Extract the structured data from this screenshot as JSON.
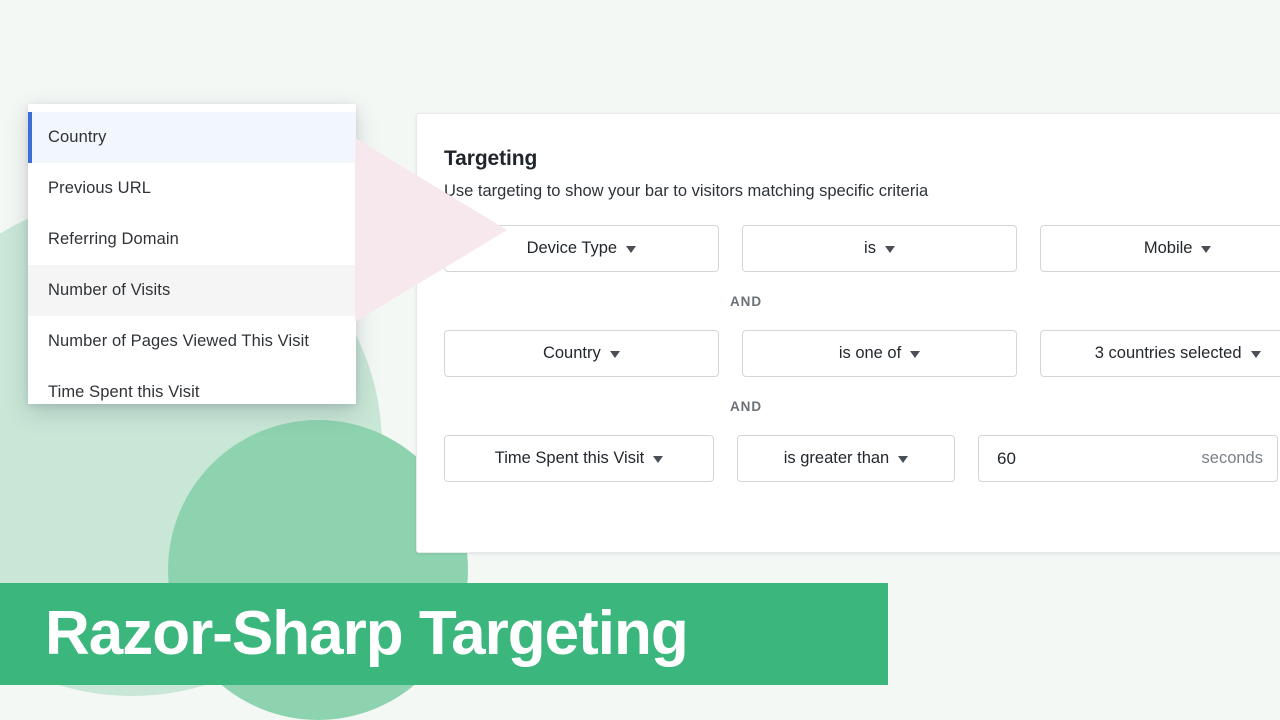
{
  "theme": {
    "page_background": "#f4f8f5",
    "accent_green": "#3bb77e",
    "shape_green_light": "#c9e7d7",
    "shape_green_mid": "#8ed3b0",
    "shape_pink": "#f6e8ec",
    "selected_blue": "#3a6fd8",
    "selected_row_bg": "#f2f6fd",
    "hover_row_bg": "#f5f5f5"
  },
  "dropdown": {
    "items": [
      {
        "label": "Country",
        "state": "selected"
      },
      {
        "label": "Previous URL",
        "state": "normal"
      },
      {
        "label": "Referring Domain",
        "state": "normal"
      },
      {
        "label": "Number of Visits",
        "state": "hovered"
      },
      {
        "label": "Number of Pages Viewed This Visit",
        "state": "normal"
      },
      {
        "label": "Time Spent this Visit",
        "state": "normal"
      }
    ]
  },
  "card": {
    "title": "Targeting",
    "subtitle": "Use targeting to show your bar to visitors matching specific criteria",
    "conjunction": "AND",
    "rules": [
      {
        "field": "Device Type",
        "operator": "is",
        "value": "Mobile"
      },
      {
        "field": "Country",
        "operator": "is one of",
        "value": "3 countries selected"
      },
      {
        "field": "Time Spent this Visit",
        "operator": "is greater than",
        "value": "60",
        "unit": "seconds",
        "placeholder": "0"
      }
    ]
  },
  "caption": {
    "text": "Razor-Sharp Targeting"
  }
}
